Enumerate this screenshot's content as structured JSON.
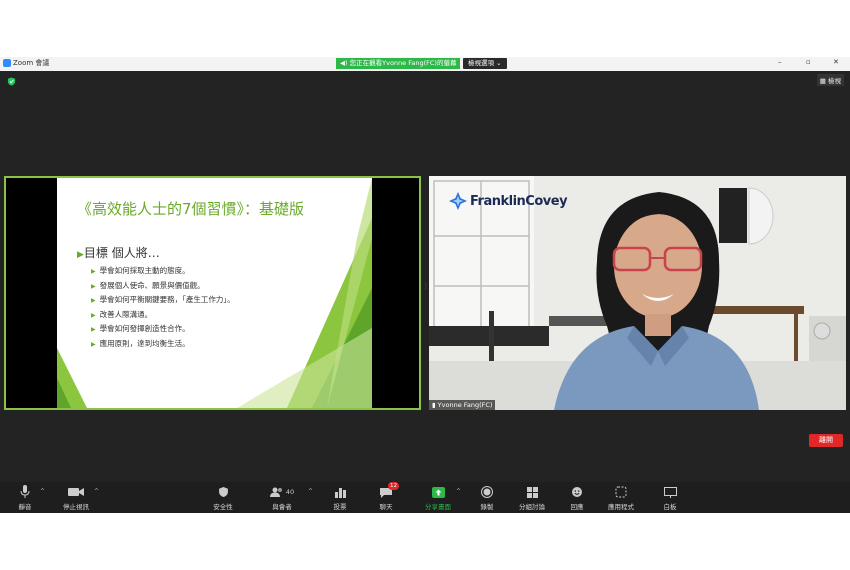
{
  "titlebar": {
    "app_title": "Zoom 會議",
    "minimize": "–",
    "restore": "▫",
    "close": "✕"
  },
  "share_banner": {
    "text": "您正在觀看Yvonne  Fang(FC)的螢幕",
    "view_options": "檢視選項"
  },
  "view_button": {
    "label": "檢視"
  },
  "slide": {
    "title": "《高效能人士的7個習慣》：基礎版",
    "heading": "目標 個人將…",
    "bullets": [
      "學會如何採取主動的態度。",
      "發展個人使命、願景與價值觀。",
      "學會如何平衡關鍵要務，「產生工作力」。",
      "改善人際溝通。",
      "學會如何發揮創造性合作。",
      "應用原則，達到均衡生活。"
    ]
  },
  "video": {
    "logo_text": "FranklinCovey",
    "participant_name": "Yvonne Fang(FC)"
  },
  "toolbar": {
    "mute": "靜音",
    "stop_video": "停止視訊",
    "security": "安全性",
    "participants": "與會者",
    "participants_count": "40",
    "polls": "投票",
    "chat": "聊天",
    "chat_badge": "12",
    "share_screen": "分享畫面",
    "record": "錄製",
    "breakout": "分組討論",
    "reactions": "回應",
    "apps": "應用程式",
    "whiteboard": "白板",
    "leave": "離開"
  },
  "colors": {
    "share_green": "#2fb84a",
    "slide_border": "#8bc34a",
    "leave_red": "#e02828",
    "dark_bg": "#232323"
  }
}
